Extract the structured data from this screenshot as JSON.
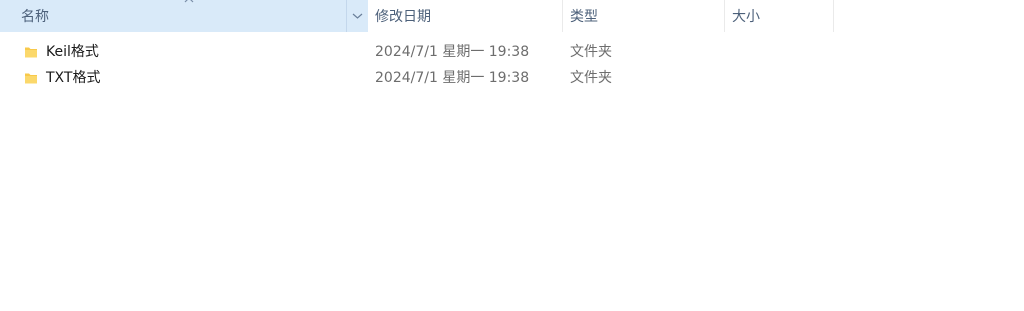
{
  "columns": {
    "name": "名称",
    "date_modified": "修改日期",
    "type": "类型",
    "size": "大小"
  },
  "sort": {
    "column": "name",
    "icon": "chevron-up-icon"
  },
  "colors": {
    "header_selected_bg": "#d9eaf9",
    "header_text": "#4c607a",
    "folder_yellow": "#f8c94a",
    "secondary_text": "#6d6d6d"
  },
  "files": [
    {
      "name": "Keil格式",
      "date_modified": "2024/7/1 星期一 19:38",
      "type": "文件夹",
      "size": "",
      "icon": "folder-icon"
    },
    {
      "name": "TXT格式",
      "date_modified": "2024/7/1 星期一 19:38",
      "type": "文件夹",
      "size": "",
      "icon": "folder-icon"
    }
  ]
}
